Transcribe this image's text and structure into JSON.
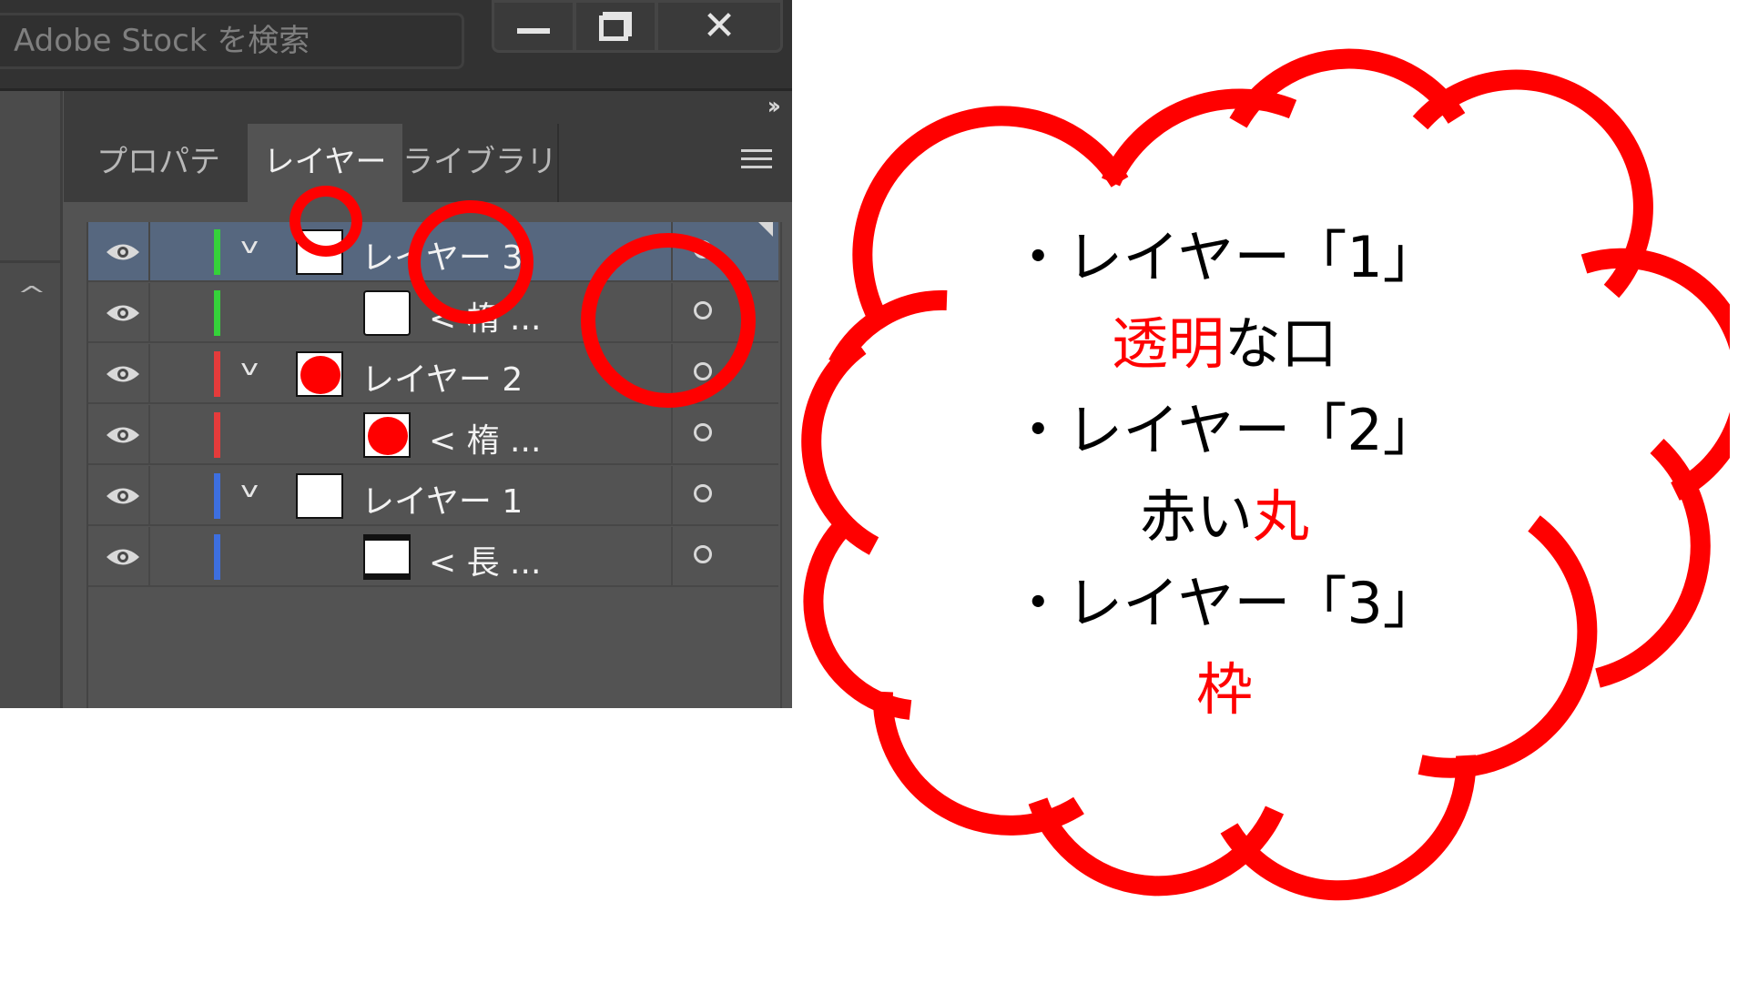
{
  "search": {
    "placeholder": "Adobe Stock を検索"
  },
  "window_buttons": {
    "minimize": "minimize-icon",
    "restore": "restore-icon",
    "close": "close-icon"
  },
  "tabs": [
    {
      "label": "プロパティ",
      "active": false
    },
    {
      "label": "レイヤー",
      "active": true
    },
    {
      "label": "ライブラリ",
      "active": false
    }
  ],
  "layers": [
    {
      "name": "レイヤー 3",
      "type": "layer",
      "color": "#35d23a",
      "selected": true
    },
    {
      "name": "< 楕 ...",
      "type": "item",
      "color": "#35d23a"
    },
    {
      "name": "レイヤー 2",
      "type": "layer",
      "color": "#e53b3b"
    },
    {
      "name": "< 楕 ...",
      "type": "item",
      "color": "#e53b3b"
    },
    {
      "name": "レイヤー 1",
      "type": "layer",
      "color": "#3d6fe0"
    },
    {
      "name": "< 長 ...",
      "type": "item",
      "color": "#3d6fe0"
    }
  ],
  "annotation": {
    "color": "#ff0000",
    "lines": [
      {
        "parts": [
          {
            "text": "・レイヤー「1」",
            "red": false
          }
        ]
      },
      {
        "parts": [
          {
            "text": "透明",
            "red": true
          },
          {
            "text": "な口",
            "red": false
          }
        ]
      },
      {
        "parts": [
          {
            "text": "・レイヤー「2」",
            "red": false
          }
        ]
      },
      {
        "parts": [
          {
            "text": "赤い",
            "red": false
          },
          {
            "text": "丸",
            "red": true
          }
        ]
      },
      {
        "parts": [
          {
            "text": "・レイヤー「3」",
            "red": false
          }
        ]
      },
      {
        "parts": [
          {
            "text": "枠",
            "red": true
          }
        ]
      }
    ]
  }
}
